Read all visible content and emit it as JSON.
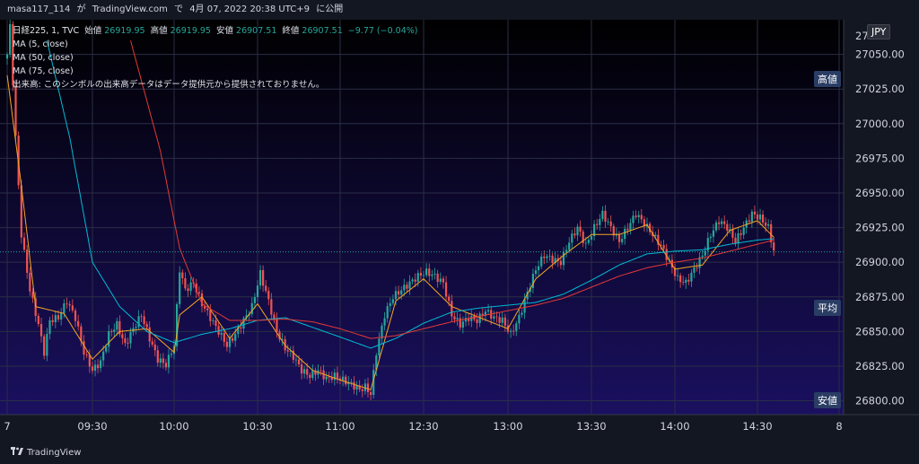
{
  "header": {
    "user": "masa117_114",
    "via": "が",
    "platform": "TradingView.com",
    "on": "で",
    "date": "4月 07, 2022 20:38 UTC+9",
    "published": "に公開"
  },
  "legend": {
    "symbol": "日経225, 1, TVC",
    "open_label": "始値",
    "open": "26919.95",
    "high_label": "高値",
    "high": "26919.95",
    "low_label": "安値",
    "low": "26907.51",
    "close_label": "終値",
    "close": "26907.51",
    "change": "−9.77 (−0.04%)",
    "ma5": "MA (5, close)",
    "ma50": "MA (50, close)",
    "ma75": "MA (75, close)",
    "volume_note": "出来高: このシンボルの出来高データはデータ提供元から提供されておりません。"
  },
  "price_scale": {
    "currency": "JPY",
    "high_tag": "高値",
    "avg_tag": "平均",
    "low_tag": "安値",
    "top_partial": "27"
  },
  "footer": {
    "brand": "TradingView"
  },
  "colors": {
    "up": "#26a69a",
    "down": "#ef5350",
    "ma5": "#f5a623",
    "ma50": "#00bcd4",
    "ma75": "#e53935",
    "tag_bg": "#2a3d64",
    "last_price_line": "#26a69a"
  },
  "chart_data": {
    "type": "candlestick",
    "title": "日経225, 1, TVC",
    "ylim": [
      26790,
      27075
    ],
    "y_ticks": [
      26800,
      26825,
      26850,
      26875,
      26900,
      26925,
      26950,
      26975,
      27000,
      27025,
      27050
    ],
    "y_tick_labels": [
      "26800.00",
      "26825.00",
      "26850.00",
      "26875.00",
      "26900.00",
      "26925.00",
      "26950.00",
      "26975.00",
      "27000.00",
      "27025.00",
      "27050.00"
    ],
    "x_tick_labels": [
      "7",
      "09:30",
      "10:00",
      "10:30",
      "11:00",
      "12:30",
      "13:00",
      "13:30",
      "14:00",
      "14:30",
      "8"
    ],
    "x_tick_minutes": [
      0,
      30,
      60,
      90,
      120,
      150,
      180,
      210,
      240,
      270,
      300
    ],
    "anchors_close": [
      [
        0,
        27050
      ],
      [
        1,
        27070
      ],
      [
        3,
        26990
      ],
      [
        5,
        26920
      ],
      [
        8,
        26880
      ],
      [
        11,
        26855
      ],
      [
        13,
        26835
      ],
      [
        15,
        26858
      ],
      [
        18,
        26860
      ],
      [
        21,
        26872
      ],
      [
        24,
        26860
      ],
      [
        27,
        26835
      ],
      [
        30,
        26822
      ],
      [
        33,
        26828
      ],
      [
        36,
        26848
      ],
      [
        39,
        26855
      ],
      [
        42,
        26840
      ],
      [
        45,
        26852
      ],
      [
        48,
        26862
      ],
      [
        51,
        26845
      ],
      [
        54,
        26830
      ],
      [
        57,
        26826
      ],
      [
        60,
        26840
      ],
      [
        62,
        26895
      ],
      [
        64,
        26880
      ],
      [
        67,
        26885
      ],
      [
        70,
        26870
      ],
      [
        73,
        26860
      ],
      [
        76,
        26850
      ],
      [
        79,
        26840
      ],
      [
        82,
        26848
      ],
      [
        85,
        26858
      ],
      [
        88,
        26868
      ],
      [
        91,
        26892
      ],
      [
        94,
        26872
      ],
      [
        97,
        26850
      ],
      [
        100,
        26838
      ],
      [
        103,
        26832
      ],
      [
        106,
        26822
      ],
      [
        109,
        26818
      ],
      [
        112,
        26822
      ],
      [
        115,
        26816
      ],
      [
        118,
        26818
      ],
      [
        121,
        26815
      ],
      [
        124,
        26812
      ],
      [
        127,
        26808
      ],
      [
        129,
        26810
      ],
      [
        131,
        26805
      ],
      [
        133,
        26835
      ],
      [
        136,
        26862
      ],
      [
        139,
        26875
      ],
      [
        142,
        26880
      ],
      [
        145,
        26885
      ],
      [
        148,
        26890
      ],
      [
        151,
        26893
      ],
      [
        154,
        26890
      ],
      [
        157,
        26885
      ],
      [
        160,
        26862
      ],
      [
        163,
        26855
      ],
      [
        166,
        26860
      ],
      [
        169,
        26858
      ],
      [
        172,
        26865
      ],
      [
        175,
        26860
      ],
      [
        178,
        26858
      ],
      [
        181,
        26848
      ],
      [
        184,
        26860
      ],
      [
        187,
        26878
      ],
      [
        190,
        26895
      ],
      [
        193,
        26905
      ],
      [
        196,
        26902
      ],
      [
        199,
        26900
      ],
      [
        202,
        26915
      ],
      [
        205,
        26925
      ],
      [
        208,
        26912
      ],
      [
        211,
        26925
      ],
      [
        214,
        26935
      ],
      [
        217,
        26925
      ],
      [
        220,
        26915
      ],
      [
        223,
        26925
      ],
      [
        226,
        26935
      ],
      [
        229,
        26928
      ],
      [
        232,
        26920
      ],
      [
        235,
        26912
      ],
      [
        238,
        26900
      ],
      [
        241,
        26888
      ],
      [
        244,
        26885
      ],
      [
        247,
        26895
      ],
      [
        250,
        26905
      ],
      [
        253,
        26920
      ],
      [
        256,
        26930
      ],
      [
        259,
        26925
      ],
      [
        262,
        26915
      ],
      [
        265,
        26925
      ],
      [
        268,
        26935
      ],
      [
        271,
        26932
      ],
      [
        274,
        26925
      ],
      [
        276,
        26908
      ]
    ],
    "ma_anchors": {
      "ma5": [
        [
          0,
          27035
        ],
        [
          5,
          26955
        ],
        [
          10,
          26868
        ],
        [
          20,
          26863
        ],
        [
          30,
          26830
        ],
        [
          40,
          26850
        ],
        [
          50,
          26852
        ],
        [
          60,
          26835
        ],
        [
          62,
          26862
        ],
        [
          70,
          26875
        ],
        [
          80,
          26845
        ],
        [
          90,
          26870
        ],
        [
          100,
          26840
        ],
        [
          110,
          26822
        ],
        [
          120,
          26815
        ],
        [
          131,
          26808
        ],
        [
          140,
          26872
        ],
        [
          150,
          26888
        ],
        [
          160,
          26868
        ],
        [
          170,
          26860
        ],
        [
          180,
          26852
        ],
        [
          190,
          26888
        ],
        [
          200,
          26905
        ],
        [
          210,
          26920
        ],
        [
          220,
          26920
        ],
        [
          230,
          26927
        ],
        [
          240,
          26895
        ],
        [
          250,
          26898
        ],
        [
          260,
          26923
        ],
        [
          270,
          26930
        ],
        [
          276,
          26918
        ]
      ],
      "ma50": [
        [
          14,
          27060
        ],
        [
          22,
          26990
        ],
        [
          30,
          26900
        ],
        [
          40,
          26868
        ],
        [
          50,
          26850
        ],
        [
          60,
          26842
        ],
        [
          70,
          26848
        ],
        [
          80,
          26852
        ],
        [
          90,
          26858
        ],
        [
          100,
          26860
        ],
        [
          110,
          26853
        ],
        [
          120,
          26846
        ],
        [
          131,
          26838
        ],
        [
          140,
          26845
        ],
        [
          150,
          26856
        ],
        [
          160,
          26864
        ],
        [
          170,
          26867
        ],
        [
          180,
          26869
        ],
        [
          190,
          26871
        ],
        [
          200,
          26877
        ],
        [
          210,
          26887
        ],
        [
          220,
          26898
        ],
        [
          230,
          26906
        ],
        [
          240,
          26908
        ],
        [
          250,
          26909
        ],
        [
          260,
          26913
        ],
        [
          270,
          26916
        ],
        [
          276,
          26917
        ]
      ],
      "ma75": [
        [
          44,
          27060
        ],
        [
          55,
          26980
        ],
        [
          62,
          26910
        ],
        [
          70,
          26870
        ],
        [
          80,
          26858
        ],
        [
          90,
          26858
        ],
        [
          100,
          26859
        ],
        [
          110,
          26857
        ],
        [
          120,
          26852
        ],
        [
          131,
          26845
        ],
        [
          140,
          26847
        ],
        [
          150,
          26852
        ],
        [
          160,
          26857
        ],
        [
          170,
          26861
        ],
        [
          180,
          26865
        ],
        [
          190,
          26869
        ],
        [
          200,
          26874
        ],
        [
          210,
          26882
        ],
        [
          220,
          26890
        ],
        [
          230,
          26896
        ],
        [
          240,
          26900
        ],
        [
          250,
          26903
        ],
        [
          260,
          26908
        ],
        [
          270,
          26913
        ],
        [
          276,
          26916
        ]
      ]
    },
    "last_price": 26907.51,
    "grid": true
  }
}
